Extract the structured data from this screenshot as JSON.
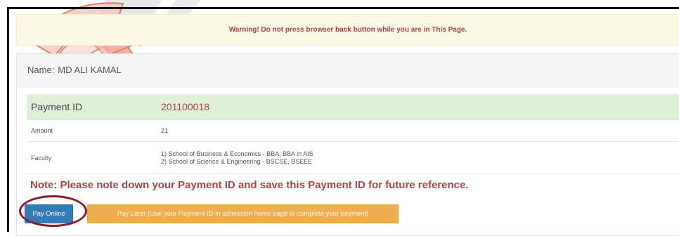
{
  "warning": {
    "text": "Warning! Do not press browser back button while you are in This Page."
  },
  "student": {
    "name_label": "Name:",
    "name_value": "MD ALI KAMAL"
  },
  "payment": {
    "id_label": "Payment ID",
    "id_value": "201100018",
    "amount_label": "Amount",
    "amount_value": "21",
    "faculty_label": "Faculty",
    "faculty_lines": [
      "1) School of Business & Economics - BBA, BBA in AIS",
      "2) School of Science & Engineering - BSCSE, BSEEE"
    ]
  },
  "note": {
    "text": "Note: Please note down your Payment ID and save this Payment ID for future reference."
  },
  "buttons": {
    "pay_online": "Pay Online",
    "pay_later": "Pay Later (Use your Payment ID in admission home page to complete your payment)"
  },
  "colors": {
    "warning_bg": "#fcf8e3",
    "warning_text": "#a94442",
    "success_bg": "#dff0d8",
    "primary": "#337ab7",
    "warning_btn": "#f0ad4e",
    "annotation": "#8b1a2a"
  }
}
